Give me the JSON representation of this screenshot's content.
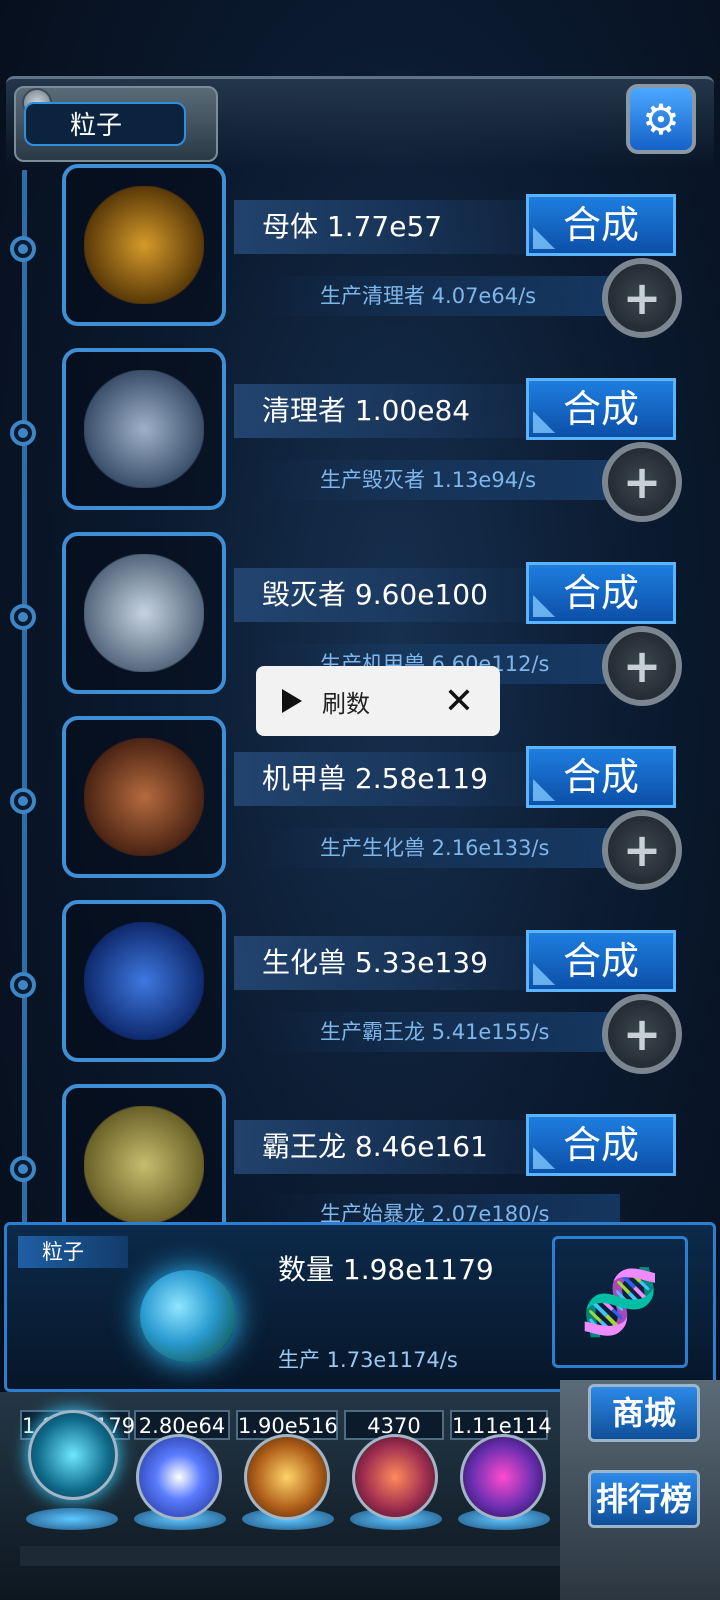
{
  "top": {
    "tab_label": "粒子"
  },
  "creatures": [
    {
      "name": "母体 1.77e57",
      "produce": "生产清理者 4.07e64/s",
      "combine": "合成",
      "art_color": "#a87318"
    },
    {
      "name": "清理者 1.00e84",
      "produce": "生产毁灭者 1.13e94/s",
      "combine": "合成",
      "art_color": "#6d85a8"
    },
    {
      "name": "毁灭者 9.60e100",
      "produce": "生产机甲兽 6.60e112/s",
      "combine": "合成",
      "art_color": "#8aa0b8"
    },
    {
      "name": "机甲兽 2.58e119",
      "produce": "生产生化兽 2.16e133/s",
      "combine": "合成",
      "art_color": "#8c4a2c"
    },
    {
      "name": "生化兽 5.33e139",
      "produce": "生产霸王龙 5.41e155/s",
      "combine": "合成",
      "art_color": "#1f4fb0"
    },
    {
      "name": "霸王龙 8.46e161",
      "produce": "生产始暴龙 2.07e180/s",
      "combine": "合成",
      "art_color": "#9a9250"
    }
  ],
  "popup": {
    "label": "刷数",
    "close_glyph": "✕"
  },
  "panel": {
    "tab_label": "粒子",
    "quantity": "数量 1.98e1179",
    "production": "生产 1.73e1174/s"
  },
  "resources": [
    "1.98e1179",
    "2.80e64",
    "1.90e516",
    "4370",
    "1.11e114"
  ],
  "side_buttons": {
    "shop": "商城",
    "ranking": "排行榜"
  }
}
